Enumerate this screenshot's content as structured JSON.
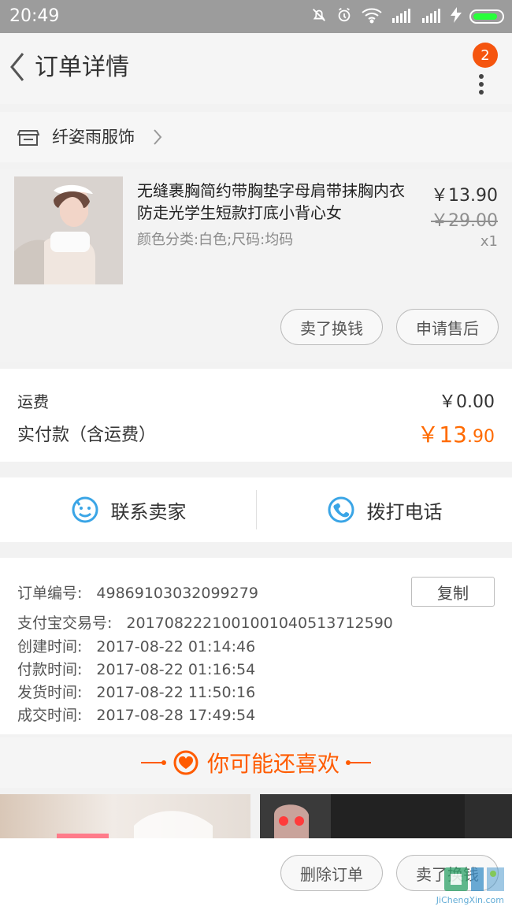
{
  "status_bar": {
    "time": "20:49",
    "icons": [
      "mute-bell-icon",
      "alarm-icon",
      "wifi-icon",
      "signal-icon",
      "signal-icon",
      "charging-icon",
      "battery-icon"
    ],
    "battery_level": 0.9
  },
  "nav": {
    "title": "订单详情",
    "badge_count": "2"
  },
  "shop": {
    "name": "纤姿雨服饰"
  },
  "product": {
    "title": "无缝裹胸简约带胸垫字母肩带抹胸内衣防走光学生短款打底小背心女",
    "spec": "颜色分类:白色;尺码:均码",
    "price_now": "￥13.90",
    "price_old": "￥29.00",
    "qty": "x1",
    "buttons": {
      "sell": "卖了换钱",
      "after_sale": "申请售后"
    }
  },
  "fees": {
    "shipping_label": "运费",
    "shipping_value": "￥0.00",
    "paid_label": "实付款（含运费）",
    "paid_value_main": "￥13",
    "paid_value_decimal": ".90"
  },
  "contact": {
    "seller": "联系卖家",
    "call": "拨打电话"
  },
  "info": {
    "order_no_label": "订单编号:",
    "order_no": "4986910303209927​9",
    "alipay_label": "支付宝交易号:",
    "alipay_no": "2017082221001001040513712590",
    "created_label": "创建时间:",
    "created": "2017-08-22 01:14:46",
    "paid_label": "付款时间:",
    "paid": "2017-08-22 01:16:54",
    "shipped_label": "发货时间:",
    "shipped": "2017-08-22 11:50:16",
    "completed_label": "成交时间:",
    "completed": "2017-08-28 17:49:54",
    "copy": "复制"
  },
  "recommend": {
    "title": "你可能还喜欢"
  },
  "bottom": {
    "delete": "删除订单",
    "sell": "卖了换钱"
  },
  "watermark": {
    "text": "JiChengXin.com"
  },
  "colors": {
    "accent_orange": "#ff6a00",
    "badge_orange": "#f5550f",
    "contact_blue": "#3aa5e6"
  }
}
